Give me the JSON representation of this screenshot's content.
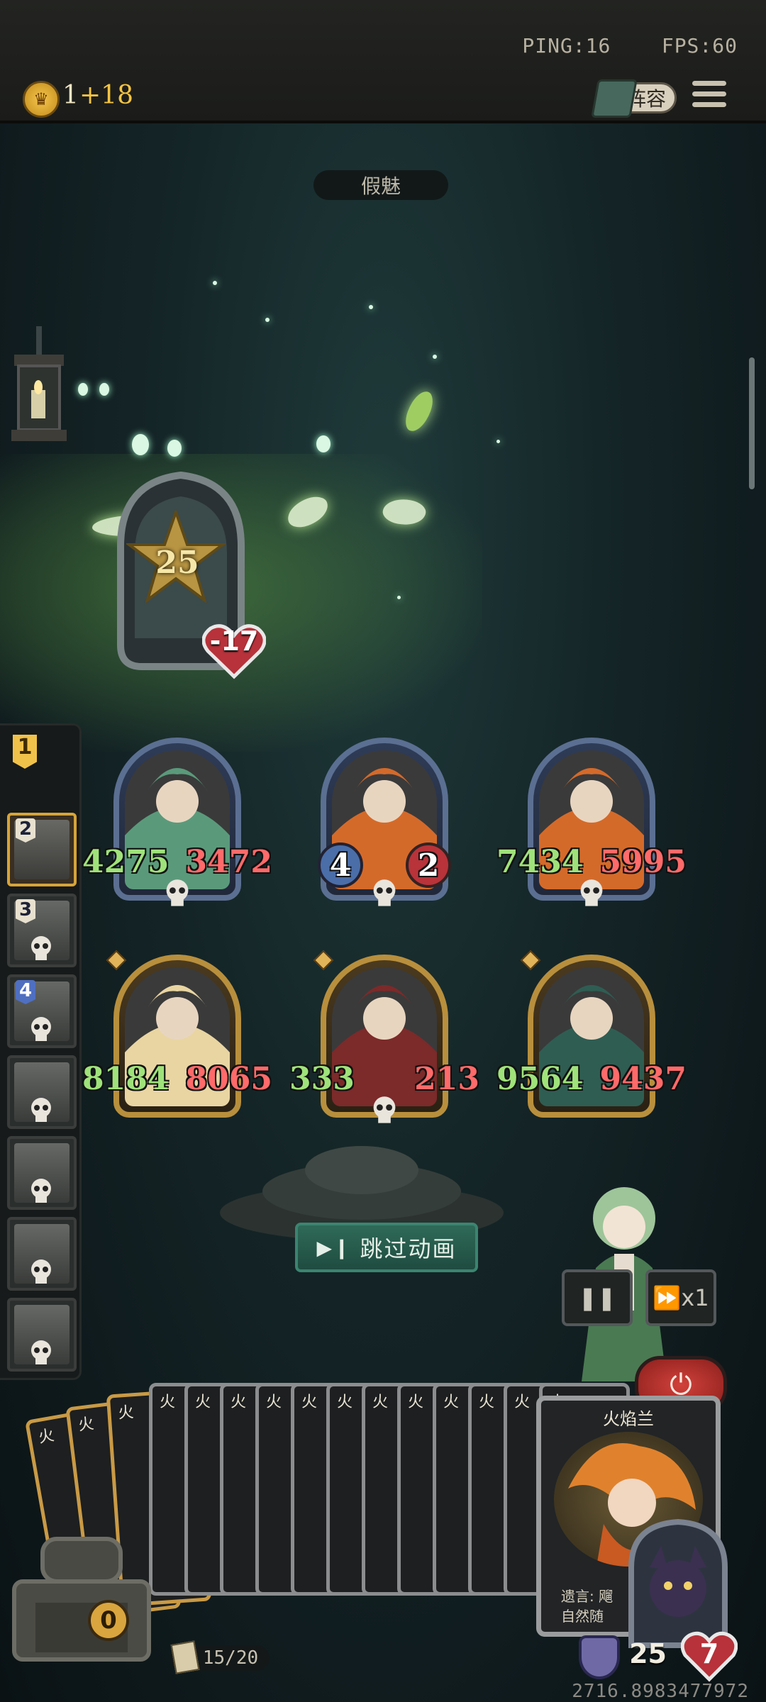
{
  "status": {
    "ping_label": "PING:16",
    "fps_label": "FPS:60"
  },
  "resources": {
    "gold": "1",
    "gold_income": "+18"
  },
  "topbar": {
    "lineup_label": "阵容"
  },
  "enemy": {
    "name": "假魅",
    "level": "25",
    "health_delta": "-17"
  },
  "recruit": {
    "turn": "1",
    "slots": [
      {
        "num": "2",
        "active": true
      },
      {
        "num": "3",
        "active": false
      },
      {
        "num": "4",
        "active": false
      },
      {
        "num": "",
        "active": false
      },
      {
        "num": "",
        "active": false
      },
      {
        "num": "",
        "active": false
      },
      {
        "num": "",
        "active": false
      }
    ]
  },
  "board": {
    "row1": [
      {
        "atk": "4275",
        "hp": "3472",
        "frame": "blue",
        "art_color": "#5a9a7b"
      },
      {
        "atk": "4",
        "hp": "2",
        "frame": "blue",
        "art_color": "#d46a2a",
        "badge": true
      },
      {
        "atk": "7434",
        "hp": "5995",
        "frame": "blue",
        "art_color": "#d46a2a"
      }
    ],
    "row2": [
      {
        "atk": "8184",
        "hp": "8065",
        "frame": "gold",
        "art_color": "#e9d5a2"
      },
      {
        "atk": "333",
        "hp": "213",
        "frame": "gold",
        "art_color": "#7c2a2a"
      },
      {
        "atk": "9564",
        "hp": "9437",
        "frame": "gold",
        "art_color": "#2f5d52"
      }
    ]
  },
  "actions": {
    "skip_label": "跳过动画",
    "pause_label": "❚❚",
    "speed_label": "x1",
    "power_label": "⏻"
  },
  "hand": {
    "card_label": "火",
    "featured_card": {
      "title": "火焰兰",
      "desc_line1": "遗言: 飗",
      "desc_line2": "自然随"
    }
  },
  "player": {
    "chest_value": "0",
    "deck": "15/20",
    "armor": "25",
    "life": "7"
  },
  "footer": {
    "mmr": "2716.8983477972"
  },
  "colors": {
    "attack": "#9fe27a",
    "health": "#ff6a6a",
    "gold": "#f5c542"
  }
}
